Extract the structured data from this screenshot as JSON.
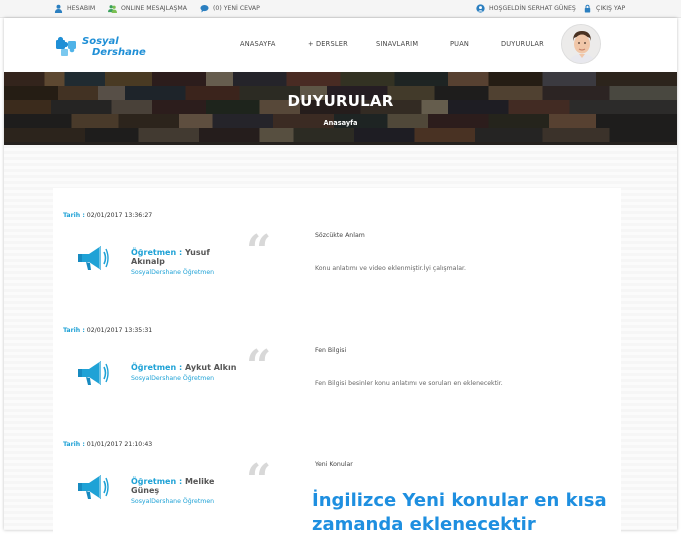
{
  "topbar": {
    "account": "HESABIM",
    "online_messaging": "ONLINE MESAJLAŞMA",
    "new_reply": "(0) YENİ CEVAP",
    "welcome": "HOŞGELDİN SERHAT GÜNEŞ",
    "logout": "ÇIKIŞ YAP"
  },
  "brand": {
    "line1": "Sosyal",
    "line2": "Dershane"
  },
  "nav": {
    "home": "ANASAYFA",
    "lessons": "+ DERSLER",
    "exams": "SINAVLARIM",
    "score": "PUAN",
    "announcements": "DUYURULAR"
  },
  "banner": {
    "title": "DUYURULAR",
    "breadcrumb": "Anasayfa"
  },
  "labels": {
    "date": "Tarih :",
    "teacher": "Öğretmen :"
  },
  "announcements": [
    {
      "date": "02/01/2017 13:36:27",
      "teacher": "Yusuf Akınalp",
      "role": "SosyalDershane Öğretmen",
      "subject": "Sözcükte Anlam",
      "body": "Konu anlatımı ve video eklenmiştir.İyi çalışmalar."
    },
    {
      "date": "02/01/2017 13:35:31",
      "teacher": "Aykut Alkın",
      "role": "SosyalDershane Öğretmen",
      "subject": "Fen Bilgisi",
      "body": "Fen Bilgisi besinler konu anlatımı ve soruları en eklenecektir."
    },
    {
      "date": "01/01/2017 21:10:43",
      "teacher": "Melike Güneş",
      "role": "SosyalDershane Öğretmen",
      "subject": "Yeni Konular",
      "body": "İngilizce Yeni konular en kısa zamanda eklenecektir"
    }
  ],
  "icons": {
    "account": "user-icon",
    "messaging": "users-icon",
    "reply": "chat-icon",
    "welcome": "user-circle-icon",
    "logout": "lock-icon",
    "announcement": "megaphone-icon"
  },
  "colors": {
    "accent": "#1fa2d6",
    "handwriting": "#1e8fe0"
  }
}
